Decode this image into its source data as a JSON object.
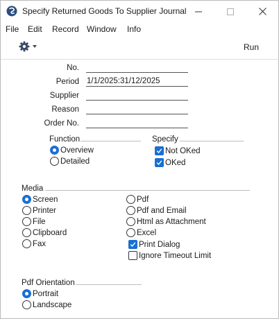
{
  "window": {
    "title": "Specify Returned Goods To Supplier Journal"
  },
  "menu": [
    "File",
    "Edit",
    "Record",
    "Window",
    "Info"
  ],
  "toolbar": {
    "run_label": "Run"
  },
  "fields": {
    "no": {
      "label": "No.",
      "value": ""
    },
    "period": {
      "label": "Period",
      "value": "1/1/2025:31/12/2025"
    },
    "supplier": {
      "label": "Supplier",
      "value": ""
    },
    "reason": {
      "label": "Reason",
      "value": ""
    },
    "order_no": {
      "label": "Order No.",
      "value": ""
    }
  },
  "function": {
    "label": "Function",
    "options": [
      {
        "label": "Overview",
        "selected": true
      },
      {
        "label": "Detailed",
        "selected": false
      }
    ]
  },
  "specify": {
    "label": "Specify",
    "options": [
      {
        "label": "Not OKed",
        "checked": true
      },
      {
        "label": "OKed",
        "checked": true
      }
    ]
  },
  "media": {
    "label": "Media",
    "left": [
      {
        "label": "Screen",
        "selected": true
      },
      {
        "label": "Printer",
        "selected": false
      },
      {
        "label": "File",
        "selected": false
      },
      {
        "label": "Clipboard",
        "selected": false
      },
      {
        "label": "Fax",
        "selected": false
      }
    ],
    "right": [
      {
        "label": "Pdf",
        "selected": false
      },
      {
        "label": "Pdf and Email",
        "selected": false
      },
      {
        "label": "Html as Attachment",
        "selected": false
      },
      {
        "label": "Excel",
        "selected": false
      }
    ],
    "print_dialog": {
      "label": "Print Dialog",
      "checked": true
    },
    "ignore_timeout": {
      "label": "Ignore Timeout Limit",
      "checked": false
    }
  },
  "pdf_orientation": {
    "label": "Pdf Orientation",
    "options": [
      {
        "label": "Portrait",
        "selected": true
      },
      {
        "label": "Landscape",
        "selected": false
      }
    ]
  }
}
